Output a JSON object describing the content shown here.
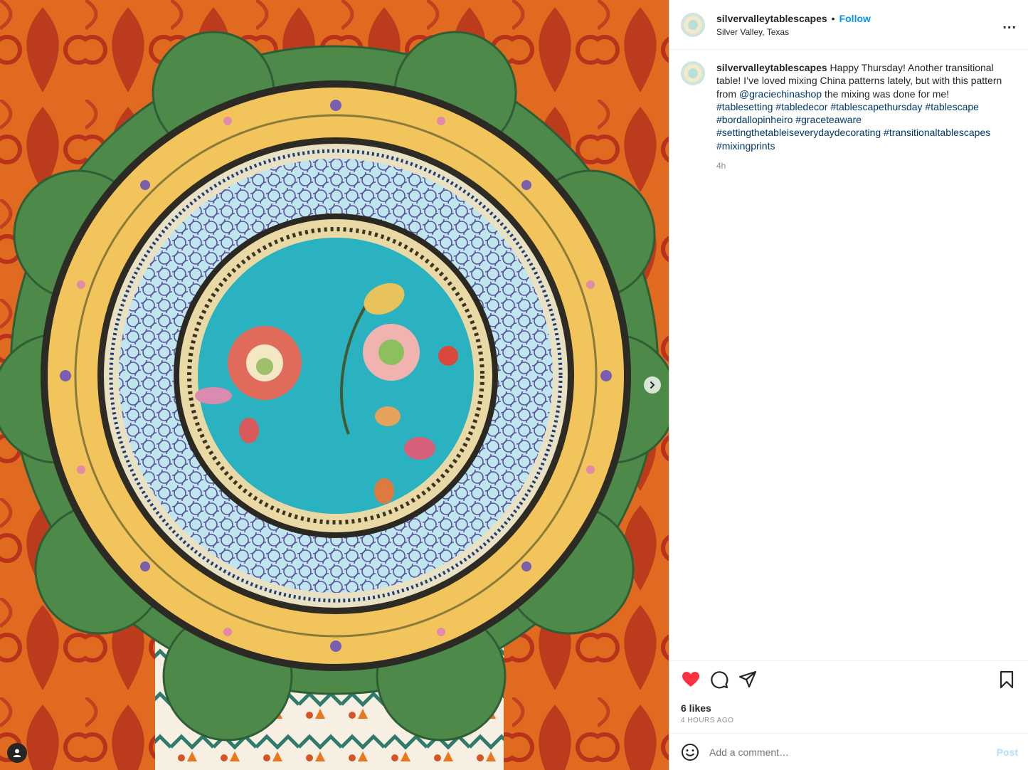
{
  "post": {
    "username": "silvervalleytablescapes",
    "follow_label": "Follow",
    "separator": "•",
    "location": "Silver Valley, Texas",
    "more_label": "...",
    "caption": {
      "username": "silvervalleytablescapes",
      "text_1": " Happy Thursday! Another transitional table! I’ve loved mixing China patterns lately, but with this pattern from ",
      "mention": "@graciechinashop",
      "text_2": " the mixing was done for me!",
      "hashtags": "#tablesetting #tabledecor #tablescapethursday #tablescape #bordallopinheiro #graceteaware #settingthetableiseverydaydecorating #transitionaltablescapes #mixingprints"
    },
    "caption_age": "4h",
    "likes": "6 likes",
    "posted_ago": "4 HOURS AGO"
  },
  "comment_box": {
    "placeholder": "Add a comment…",
    "post_label": "Post"
  },
  "icons": {
    "like": "heart-icon",
    "comment": "comment-icon",
    "share": "send-icon",
    "save": "bookmark-icon",
    "emoji": "emoji-icon",
    "next": "chevron-right-icon",
    "tag": "user-tag-icon"
  },
  "colors": {
    "link": "#00376b",
    "follow": "#0095f6",
    "liked": "#ff3040",
    "post_disabled": "#b2dffc"
  }
}
